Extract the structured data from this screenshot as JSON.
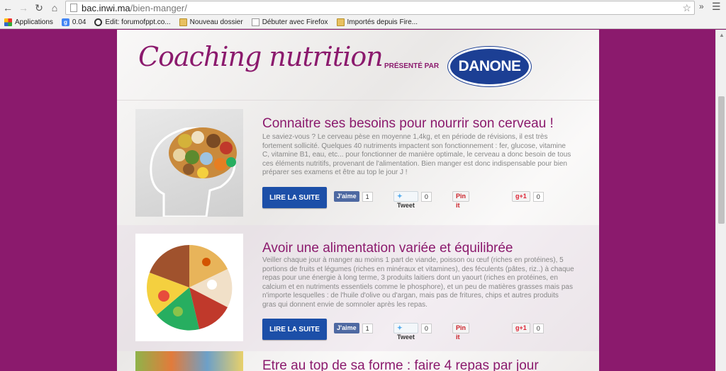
{
  "browser": {
    "url_host": "bac.inwi.ma",
    "url_path": "/bien-manger/",
    "back_icon": "back-arrow-icon",
    "forward_icon": "forward-arrow-icon",
    "reload_icon": "reload-icon",
    "home_icon": "home-icon",
    "star_icon": "star-icon",
    "extensions_label": "»",
    "menu_icon": "hamburger-menu-icon"
  },
  "bookmarks": [
    {
      "label": "Applications",
      "icon": "apps-grid-icon"
    },
    {
      "label": "0.04",
      "icon": "google-icon"
    },
    {
      "label": "Edit: forumofppt.co...",
      "icon": "edit-site-icon"
    },
    {
      "label": "Nouveau dossier",
      "icon": "folder-icon"
    },
    {
      "label": "Débuter avec Firefox",
      "icon": "page-icon"
    },
    {
      "label": "Importés depuis Fire...",
      "icon": "folder-icon"
    }
  ],
  "header": {
    "title": "Coaching nutrition",
    "presented_by": "PRÉSENTÉ PAR",
    "sponsor": "DANONE"
  },
  "articles": [
    {
      "title": "Connaitre ses besoins pour nourrir son cerveau !",
      "description": "Le saviez-vous ? Le cerveau pèse en moyenne 1,4kg, et en période de révisions, il est très fortement sollicité. Quelques 40 nutriments impactent son fonctionnement : fer, glucose, vitamine C, vitamine B1, eau, etc... pour fonctionner de manière optimale, le cerveau a donc besoin de tous ces éléments nutritifs, provenant de l'alimentation. Bien manger est donc indispensable pour bien préparer ses examens et être au top le jour J !",
      "read_more": "LIRE LA SUITE",
      "fb_label": "J'aime",
      "fb_count": "1",
      "tw_label": "Tweet",
      "tw_count": "0",
      "pin_label": "Pin it",
      "gp_label": "+1",
      "gp_count": "0"
    },
    {
      "title": "Avoir une alimentation variée et équilibrée",
      "description": "Veiller chaque jour à manger au moins 1 part de viande, poisson ou œuf (riches en protéines), 5 portions de fruits et légumes (riches en minéraux et vitamines), des féculents (pâtes, riz..) à chaque repas pour une énergie à long terme, 3 produits laitiers dont un yaourt (riches en protéines, en calcium et en nutriments essentiels comme le phosphore), et un peu de matières grasses mais pas n'importe lesquelles : de l'huile d'olive ou d'argan, mais pas de fritures, chips et autres produits gras qui donnent envie de somnoler après les repas.",
      "read_more": "LIRE LA SUITE",
      "fb_label": "J'aime",
      "fb_count": "1",
      "tw_label": "Tweet",
      "tw_count": "0",
      "pin_label": "Pin it",
      "gp_label": "+1",
      "gp_count": "0"
    },
    {
      "title": "Etre au top de sa forme : faire 4 repas par jour"
    }
  ]
}
